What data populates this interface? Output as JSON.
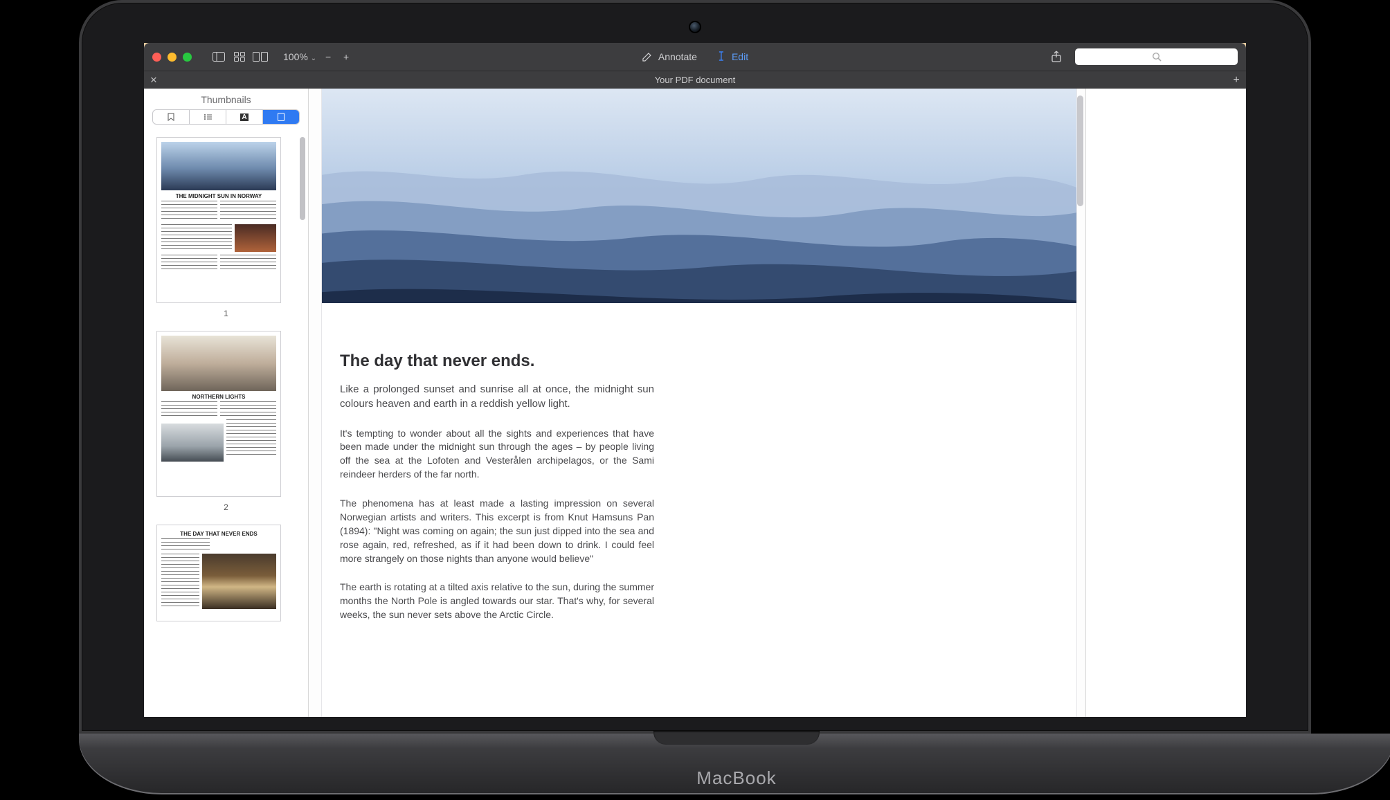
{
  "laptop": {
    "brand": "MacBook"
  },
  "toolbar": {
    "zoom": "100%",
    "annotate_label": "Annotate",
    "edit_label": "Edit",
    "search_placeholder": "",
    "icons": {
      "sidebar": "sidebar-icon",
      "grid": "thumbnail-grid-icon",
      "twopage": "two-page-icon",
      "chevron": "chevron-down-icon",
      "minus": "−",
      "plus": "+",
      "annotate": "pencil-icon",
      "edit": "text-cursor-icon",
      "share": "share-icon",
      "search": "search-icon"
    }
  },
  "tabbar": {
    "close": "✕",
    "title": "Your PDF document",
    "add": "+"
  },
  "sidebar": {
    "title": "Thumbnails",
    "segments": {
      "bookmarks": "bookmarks-icon",
      "outline": "outline-icon",
      "annotations": "annotations-icon",
      "thumbnails": "thumbnails-icon"
    },
    "thumbs": [
      {
        "num": "1",
        "title": "THE MIDNIGHT SUN IN NORWAY"
      },
      {
        "num": "2",
        "title": "NORTHERN LIGHTS"
      },
      {
        "num": "",
        "title": "THE DAY THAT NEVER ENDS"
      }
    ]
  },
  "doc": {
    "heading": "The day that never ends.",
    "p1": "Like a prolonged sunset and sunrise all at once, the midnight sun colours heaven and earth in a reddish yellow light.",
    "p2": "It's tempting to wonder about all the sights and experiences that have been made under the midnight sun through the ages – by people living off the sea at the Lofoten and Vesterålen archipelagos, or the Sami reindeer herders of the far north.",
    "p3": "The phenomena has at least made a lasting impression on several Norwegian artists and writers. This excerpt is from Knut Hamsuns Pan (1894): \"Night was coming on again; the sun just dipped into the sea and rose again, red, refreshed, as if it had been down to drink. I could feel more strangely on those nights than anyone would believe\"",
    "p4": "The earth is rotating at a tilted axis relative to the sun, during the summer months the North Pole is angled towards our star. That's why, for several weeks, the sun never sets above the Arctic Circle."
  }
}
